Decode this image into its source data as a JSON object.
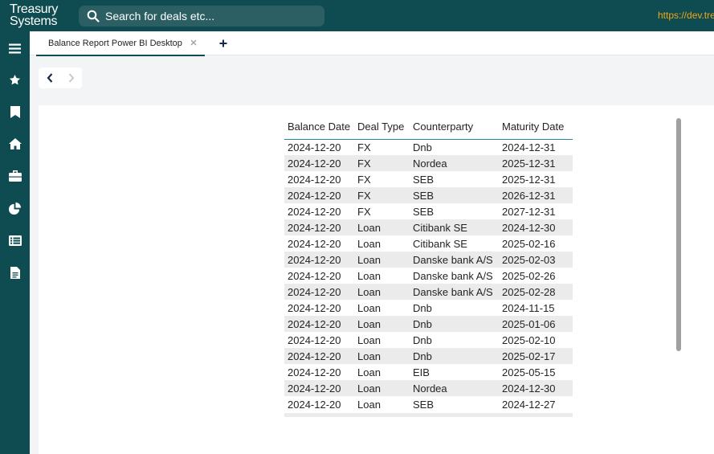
{
  "brand": {
    "line1": "Treasury",
    "line2": "Systems"
  },
  "search": {
    "placeholder": "Search for deals etc..."
  },
  "url": "https://dev.tre",
  "sidebar": {
    "items": [
      {
        "icon": "menu-icon"
      },
      {
        "icon": "star-icon"
      },
      {
        "icon": "bookmark-icon"
      },
      {
        "icon": "home-icon"
      },
      {
        "icon": "briefcase-icon"
      },
      {
        "icon": "pie-chart-icon"
      },
      {
        "icon": "list-icon"
      },
      {
        "icon": "document-icon"
      }
    ]
  },
  "tabs": [
    {
      "label": "Balance Report Power BI Desktop",
      "active": true
    }
  ],
  "table": {
    "headers": [
      "Balance Date",
      "Deal Type",
      "Counterparty",
      "Maturity Date"
    ],
    "rows": [
      [
        "2024-12-20",
        "FX",
        "Dnb",
        "2024-12-31"
      ],
      [
        "2024-12-20",
        "FX",
        "Nordea",
        "2025-12-31"
      ],
      [
        "2024-12-20",
        "FX",
        "SEB",
        "2025-12-31"
      ],
      [
        "2024-12-20",
        "FX",
        "SEB",
        "2026-12-31"
      ],
      [
        "2024-12-20",
        "FX",
        "SEB",
        "2027-12-31"
      ],
      [
        "2024-12-20",
        "Loan",
        "Citibank SE",
        "2024-12-30"
      ],
      [
        "2024-12-20",
        "Loan",
        "Citibank SE",
        "2025-02-16"
      ],
      [
        "2024-12-20",
        "Loan",
        "Danske bank A/S",
        "2025-02-03"
      ],
      [
        "2024-12-20",
        "Loan",
        "Danske bank A/S",
        "2025-02-26"
      ],
      [
        "2024-12-20",
        "Loan",
        "Danske bank A/S",
        "2025-02-28"
      ],
      [
        "2024-12-20",
        "Loan",
        "Dnb",
        "2024-11-15"
      ],
      [
        "2024-12-20",
        "Loan",
        "Dnb",
        "2025-01-06"
      ],
      [
        "2024-12-20",
        "Loan",
        "Dnb",
        "2025-02-10"
      ],
      [
        "2024-12-20",
        "Loan",
        "Dnb",
        "2025-02-17"
      ],
      [
        "2024-12-20",
        "Loan",
        "EIB",
        "2025-05-15"
      ],
      [
        "2024-12-20",
        "Loan",
        "Nordea",
        "2024-12-30"
      ],
      [
        "2024-12-20",
        "Loan",
        "SEB",
        "2024-12-27"
      ]
    ]
  },
  "colors": {
    "brand_dark": "#0f4c52",
    "search_bg": "#2b5f64",
    "url_color": "#f3a515",
    "header_rule": "#1e8c9a"
  }
}
